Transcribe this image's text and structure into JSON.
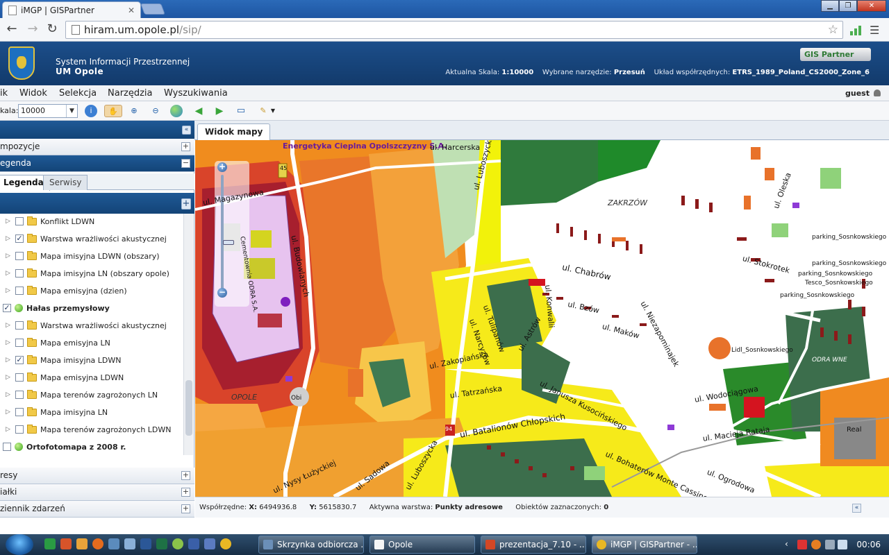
{
  "browser": {
    "tab_title": "iMGP | GISPartner",
    "url_host": "hiram.um.opole.pl",
    "url_path": "/sip/"
  },
  "header": {
    "title_line1": "System Informacji Przestrzennej",
    "title_line2": "UM Opole",
    "brand": "GIS Partner",
    "scale_label": "Aktualna Skala:",
    "scale_value": "1:10000",
    "tool_label": "Wybrane narzędzie:",
    "tool_value": "Przesuń",
    "crs_label": "Układ współrzędnych:",
    "crs_value": "ETRS_1989_Poland_CS2000_Zone_6"
  },
  "menu": {
    "items": [
      "ik",
      "Widok",
      "Selekcja",
      "Narzędzia",
      "Wyszukiwania"
    ],
    "user": "guest"
  },
  "toolbar": {
    "scale_label": "kala:",
    "scale_value": "10000"
  },
  "leftpanel": {
    "sections_top": [
      {
        "label": "mpozycje",
        "state": "+"
      },
      {
        "label": "egenda",
        "state": "−"
      }
    ],
    "subtabs": [
      "Legenda",
      "Serwisy"
    ],
    "add_button": "+",
    "layers": [
      {
        "label": "Konflikt LDWN",
        "checked": false,
        "type": "folder"
      },
      {
        "label": "Warstwa wrażliwości akustycznej",
        "checked": true,
        "type": "folder"
      },
      {
        "label": "Mapa imisyjna LDWN (obszary)",
        "checked": false,
        "type": "folder"
      },
      {
        "label": "Mapa imisyjna LN (obszary opole)",
        "checked": false,
        "type": "folder"
      },
      {
        "label": "Mapa emisyjna (dzien)",
        "checked": false,
        "type": "folder"
      },
      {
        "label": "Hałas przemysłowy",
        "checked": true,
        "type": "group"
      },
      {
        "label": "Warstwa wrażliwości akustycznej",
        "checked": false,
        "type": "folder"
      },
      {
        "label": "Mapa emisyjna LN",
        "checked": false,
        "type": "folder"
      },
      {
        "label": "Mapa imisyjna LDWN",
        "checked": true,
        "type": "folder"
      },
      {
        "label": "Mapa emisyjna LDWN",
        "checked": false,
        "type": "folder"
      },
      {
        "label": "Mapa terenów zagrożonych LN",
        "checked": false,
        "type": "folder"
      },
      {
        "label": "Mapa imisyjna LN",
        "checked": false,
        "type": "folder"
      },
      {
        "label": "Mapa terenów zagrożonych LDWN",
        "checked": false,
        "type": "folder"
      },
      {
        "label": "Ortofotomapa z 2008 r.",
        "checked": false,
        "type": "group"
      }
    ],
    "sections_bottom": [
      {
        "label": "resy",
        "state": "+"
      },
      {
        "label": "iałki",
        "state": "+"
      },
      {
        "label": "ziennik zdarzeń",
        "state": "+"
      }
    ]
  },
  "map": {
    "tab": "Widok mapy",
    "labels": [
      "Energetyka Cieplna Opolszczyzny S.A.",
      "ul. Harcerska",
      "ul. Luboszycka",
      "ul. Magazynowa",
      "ul. Budowlanych",
      "ZAKRZÓW",
      "parking_Sosnkowskiego",
      "parking_Sosnkowskiego",
      "parking_Sosnkowskiego",
      "Tesco_Sosnkowskiego",
      "parking_Sosnkowskiego",
      "ul. Chabrów",
      "ul. Oleska",
      "ul. Stokrotek",
      "ul. Bzów",
      "ul. Tulipanów",
      "ul. Narcyzów",
      "ul. Astrów",
      "ul. Konwalii",
      "ul. Maków",
      "ul. Niezapominajek",
      "ul. Zakopiańska",
      "ul. Tatrzańska",
      "ul. Janusza Kusocińskiego",
      "ul. Wodociągowa",
      "Lidl_Sosnkowskiego",
      "OPOLE",
      "Obi",
      "ul. Batalionów Chłopskich",
      "ul. Macieja Rataja",
      "ul. Bohaterów Monte Cassino",
      "ul. Ogrodowa",
      "ul. Nysy Łużyckiej",
      "ul. Sadowa",
      "ul. Luboszycka",
      "Real",
      "Cementownia ODRA S.A.",
      "ODRA WNE",
      "45",
      "94"
    ]
  },
  "statusbar": {
    "coords_label": "Współrzędne:",
    "x_label": "X:",
    "x_value": "6494936.8",
    "y_label": "Y:",
    "y_value": "5615830.7",
    "layer_label": "Aktywna warstwa:",
    "layer_value": "Punkty adresowe",
    "selected_label": "Obiektów zaznaczonych:",
    "selected_value": "0"
  },
  "taskbar": {
    "buttons": [
      "Skrzynka odbiorcza ...",
      "Opole",
      "prezentacja_7.10 - ...",
      "iMGP | GISPartner - ..."
    ],
    "clock": "00:06"
  }
}
